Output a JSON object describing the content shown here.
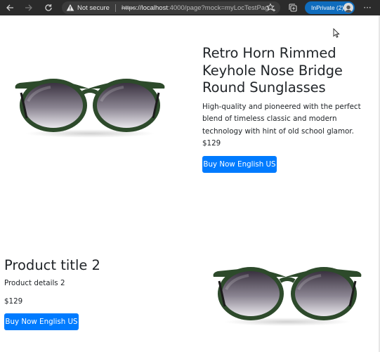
{
  "browser": {
    "back_icon": "arrow-left-icon",
    "forward_icon": "arrow-right-icon",
    "reload_icon": "reload-icon",
    "security_label": "Not secure",
    "url_scheme": "https",
    "url_host": "://localhost",
    "url_rest": ":4000/page?mock=myLocTestPag...",
    "inprivate_label": "InPrivate (2)",
    "more_label": "···",
    "accent_color": "#0f6cbd"
  },
  "products": [
    {
      "title": "Retro Horn Rimmed Keyhole Nose Bridge Round Sunglasses",
      "details": "High-quality and pioneered with the perfect blend of timeless classic and modern technology with hint of old school glamor.",
      "price": "$129",
      "buy_label": "Buy Now English US"
    },
    {
      "title": "Product title 2",
      "details": "Product details 2",
      "price": "$129",
      "buy_label": "Buy Now English US"
    }
  ],
  "colors": {
    "button": "#007bff",
    "frame": "#2c4a2c"
  }
}
